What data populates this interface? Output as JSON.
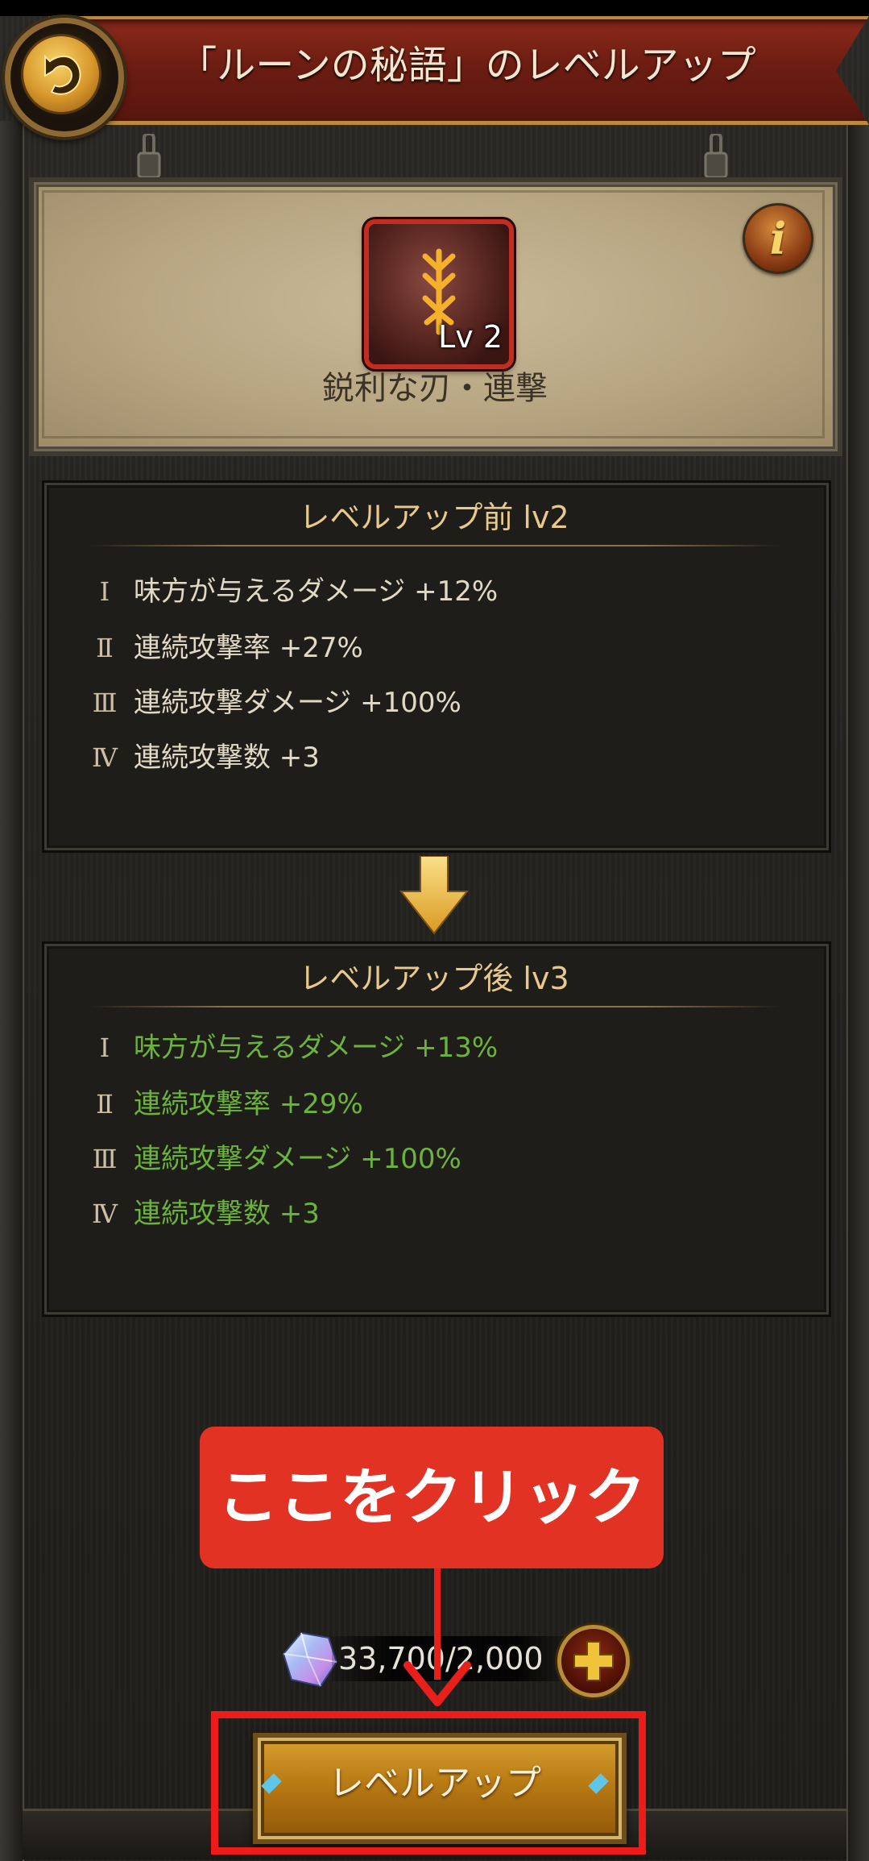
{
  "header": {
    "title": "「ルーンの秘語」のレベルアップ"
  },
  "rune": {
    "level_label": "Lv 2",
    "name": "鋭利な刃・連撃"
  },
  "before": {
    "title": "レベルアップ前 lv2",
    "stats": [
      {
        "num": "Ⅰ",
        "text": "味方が与えるダメージ +12%"
      },
      {
        "num": "Ⅱ",
        "text": "連続攻撃率 +27%"
      },
      {
        "num": "Ⅲ",
        "text": "連続攻撃ダメージ +100%"
      },
      {
        "num": "Ⅳ",
        "text": "連続攻撃数 +3"
      }
    ]
  },
  "after": {
    "title": "レベルアップ後 lv3",
    "stats": [
      {
        "num": "Ⅰ",
        "text": "味方が与えるダメージ +13%"
      },
      {
        "num": "Ⅱ",
        "text": "連続攻撃率 +29%"
      },
      {
        "num": "Ⅲ",
        "text": "連続攻撃ダメージ +100%"
      },
      {
        "num": "Ⅳ",
        "text": "連続攻撃数 +3"
      }
    ]
  },
  "callout": {
    "text": "ここをクリック"
  },
  "cost": {
    "text": "33,700/2,000"
  },
  "button": {
    "label": "レベルアップ"
  },
  "colors": {
    "accent_green": "#6bb33a",
    "panel_title_gold": "#e7c98d",
    "callout_red": "#e13224",
    "banner_red": "#8c2a1b"
  },
  "icons": {
    "back": "back-arrow-icon",
    "info": "info-icon",
    "gem": "gem-icon",
    "plus": "plus-icon",
    "arrow": "down-arrow-icon"
  }
}
